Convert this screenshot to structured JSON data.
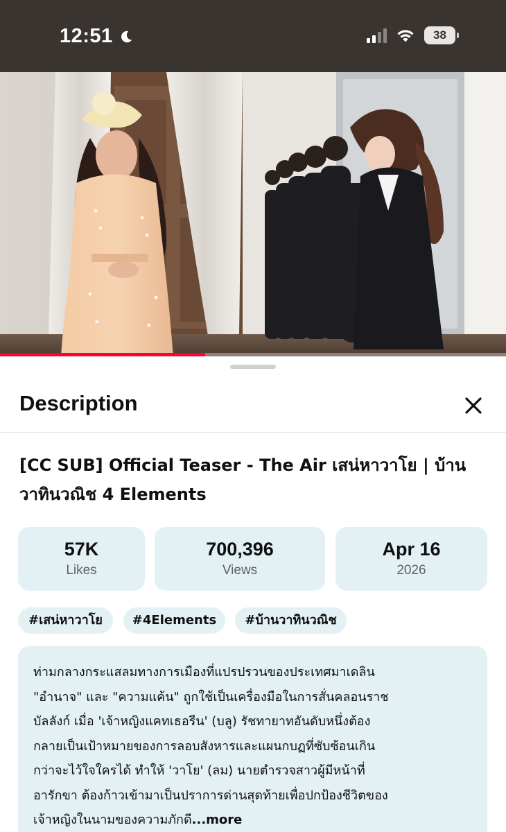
{
  "status_bar": {
    "time": "12:51",
    "battery": "38",
    "icons": [
      "moon-icon",
      "cellular-signal-icon",
      "wifi-icon",
      "battery-icon"
    ]
  },
  "video": {
    "progress_fraction": 0.405,
    "progress_color": "#ff0033"
  },
  "sheet": {
    "title": "Description",
    "close_icon": "close-icon",
    "video_title_line1": "[CC SUB] Official Teaser - The Air เสน่หาวาโย | บ้าน",
    "video_title_line2": "วาทินวณิช 4 Elements",
    "stats": [
      {
        "value": "57K",
        "label": "Likes"
      },
      {
        "value": "700,396",
        "label": "Views"
      },
      {
        "value": "Apr 16",
        "label": "2026"
      }
    ],
    "tags": [
      "#เสน่หาวาโย",
      "#4Elements",
      "#บ้านวาทินวณิช"
    ],
    "description_lines": [
      "ท่ามกลางกระแสลมทางการเมืองที่แปรปรวนของประเทศมาเดลิน",
      "\"อำนาจ\" และ \"ความแค้น\" ถูกใช้เป็นเครื่องมือในการสั่นคลอนราช",
      "บัลลังก์ เมื่อ 'เจ้าหญิงแคทเธอรีน' (บลู) รัชทายาทอันดับหนึ่งต้อง",
      "กลายเป็นเป้าหมายของการลอบสังหารและแผนกบฏที่ซับซ้อนเกิน",
      "กว่าจะไว้ใจใครได้ ทำให้ 'วาโย' (ลม) นายตำรวจสาวผู้มีหน้าที่",
      "อารักขา ต้องก้าวเข้ามาเป็นปราการด่านสุดท้ายเพื่อปกป้องชีวิตของ",
      "เจ้าหญิงในนามของความภักดี"
    ],
    "more_label": "...more"
  },
  "colors": {
    "status_bar_bg": "#3a3431",
    "chip_bg": "#e3f1f5",
    "text_primary": "#0f0f0f",
    "text_secondary": "#606060"
  }
}
